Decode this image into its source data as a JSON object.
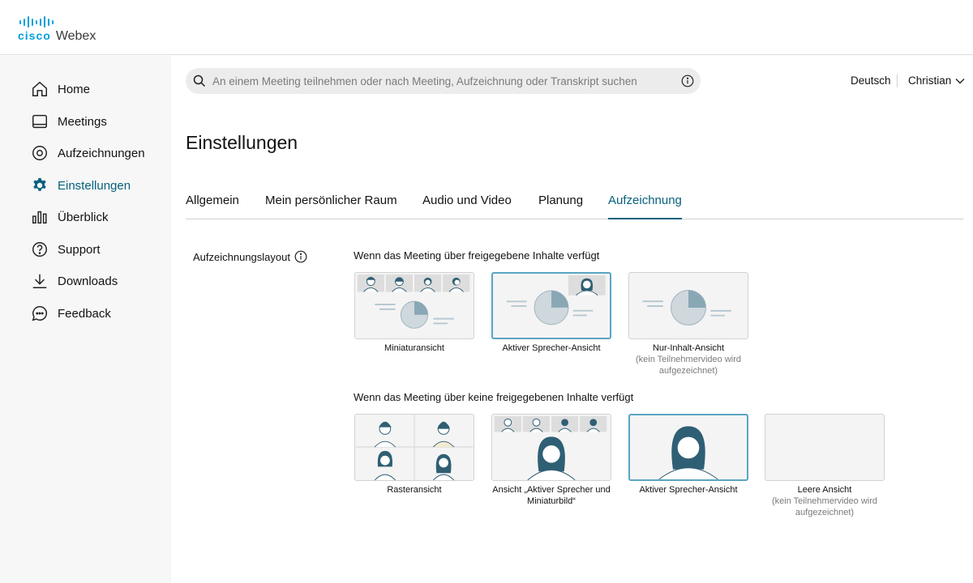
{
  "brand": {
    "cisco": "cisco",
    "webex": "Webex",
    "color": "#049fd9"
  },
  "colors": {
    "accent": "#07607e",
    "selected_border": "#5aa5c2",
    "illustration": "#2f5f74"
  },
  "sidebar": {
    "items": [
      {
        "label": "Home",
        "icon": "home-icon"
      },
      {
        "label": "Meetings",
        "icon": "meetings-icon"
      },
      {
        "label": "Aufzeichnungen",
        "icon": "recordings-icon"
      },
      {
        "label": "Einstellungen",
        "icon": "gear-icon",
        "active": true
      },
      {
        "label": "Überblick",
        "icon": "bar-chart-icon"
      },
      {
        "label": "Support",
        "icon": "help-icon"
      },
      {
        "label": "Downloads",
        "icon": "download-icon"
      },
      {
        "label": "Feedback",
        "icon": "feedback-icon"
      }
    ]
  },
  "search": {
    "placeholder": "An einem Meeting teilnehmen oder nach Meeting, Aufzeichnung oder Transkript suchen"
  },
  "header": {
    "language": "Deutsch",
    "user": "Christian"
  },
  "page": {
    "title": "Einstellungen"
  },
  "tabs": [
    {
      "label": "Allgemein"
    },
    {
      "label": "Mein persönlicher Raum"
    },
    {
      "label": "Audio und Video"
    },
    {
      "label": "Planung"
    },
    {
      "label": "Aufzeichnung",
      "active": true
    }
  ],
  "recording": {
    "section_label": "Aufzeichnungslayout",
    "shared": {
      "heading": "Wenn das Meeting über freigegebene Inhalte verfügt",
      "options": [
        {
          "label": "Miniaturansicht",
          "sub": "",
          "selected": false
        },
        {
          "label": "Aktiver Sprecher-Ansicht",
          "sub": "",
          "selected": true
        },
        {
          "label": "Nur-Inhalt-Ansicht",
          "sub": "(kein Teilnehmervideo wird aufgezeichnet)",
          "selected": false
        }
      ]
    },
    "noshared": {
      "heading": "Wenn das Meeting über keine freigegebenen Inhalte verfügt",
      "options": [
        {
          "label": "Rasteransicht",
          "sub": "",
          "selected": false
        },
        {
          "label": "Ansicht „Aktiver Sprecher und Miniaturbild“",
          "sub": "",
          "selected": false
        },
        {
          "label": "Aktiver Sprecher-Ansicht",
          "sub": "",
          "selected": true
        },
        {
          "label": "Leere Ansicht",
          "sub": "(kein Teilnehmervideo wird aufgezeichnet)",
          "selected": false
        }
      ]
    }
  }
}
